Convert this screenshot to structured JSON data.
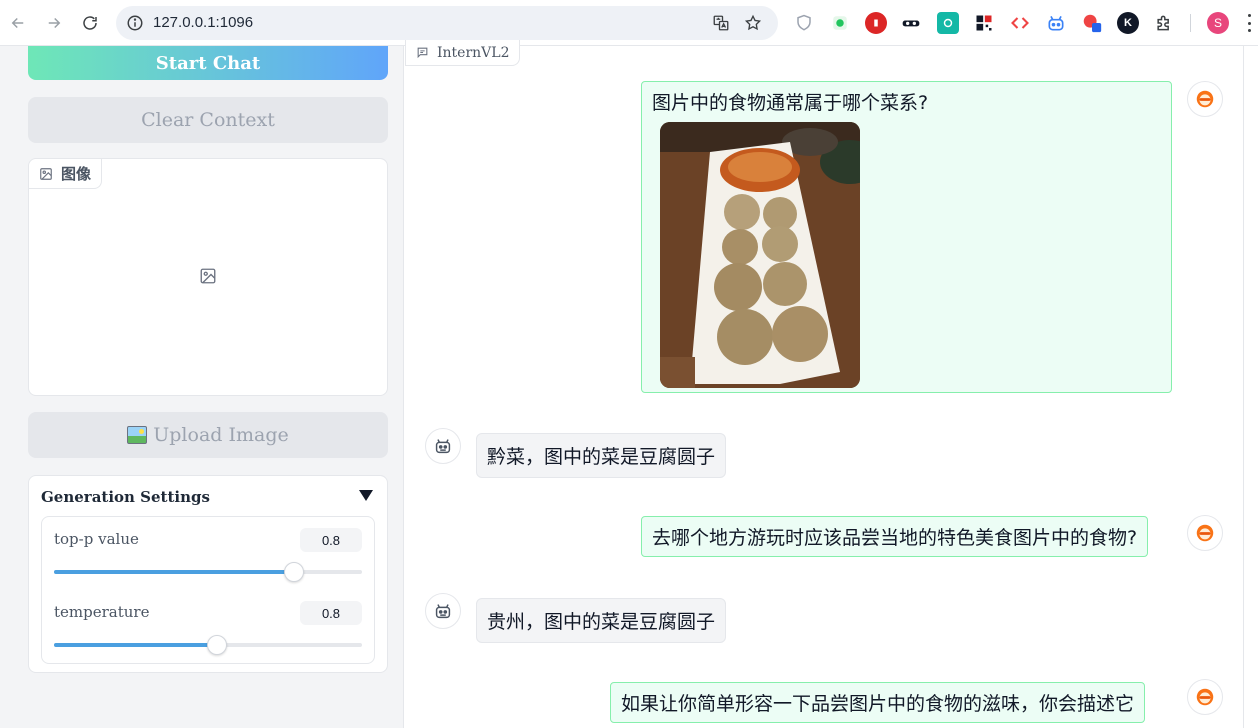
{
  "browser": {
    "url": "127.0.0.1:1096",
    "profile_initial": "S",
    "extensions": [
      {
        "name": "shield-icon",
        "color": "#9ca3af"
      },
      {
        "name": "evernote-icon",
        "color": "#22c55e"
      },
      {
        "name": "adblock-icon",
        "color": "#dc2626"
      },
      {
        "name": "incognito-mask-icon",
        "color": "#111827"
      },
      {
        "name": "teal-square-icon",
        "color": "#14b8a6"
      },
      {
        "name": "qr-code-icon",
        "color": "#111827"
      },
      {
        "name": "code-brackets-icon",
        "color": "#ef4444"
      },
      {
        "name": "robot-icon",
        "color": "#3b82f6"
      },
      {
        "name": "red-record-icon",
        "color": "#ef4444"
      },
      {
        "name": "k-circle-icon",
        "color": "#111827"
      },
      {
        "name": "puzzle-icon",
        "color": "#3c4043"
      }
    ]
  },
  "sidebar": {
    "start_chat": "Start Chat",
    "clear_context": "Clear Context",
    "image_label": "图像",
    "upload_image": "Upload Image",
    "generation": {
      "title": "Generation Settings",
      "sliders": [
        {
          "label": "top-p value",
          "value": "0.8",
          "fraction": 0.78
        },
        {
          "label": "temperature",
          "value": "0.8",
          "fraction": 0.53
        }
      ]
    }
  },
  "chat": {
    "label": "InternVL2",
    "messages": [
      {
        "role": "user",
        "text": "图片中的食物通常属于哪个菜系?"
      },
      {
        "role": "bot",
        "text": "黔菜，图中的菜是豆腐圆子"
      },
      {
        "role": "user",
        "text": "去哪个地方游玩时应该品尝当地的特色美食图片中的食物?"
      },
      {
        "role": "bot",
        "text": "贵州，图中的菜是豆腐圆子"
      },
      {
        "role": "user",
        "text": "如果让你简单形容一下品尝图片中的食物的滋味，你会描述它"
      }
    ]
  },
  "colors": {
    "start_gradient_from": "#6ee7b7",
    "start_gradient_to": "#60a5fa",
    "slider_fill": "#4a9fe0",
    "user_bubble_bg": "#ecfdf5",
    "user_bubble_border": "#86efac"
  }
}
